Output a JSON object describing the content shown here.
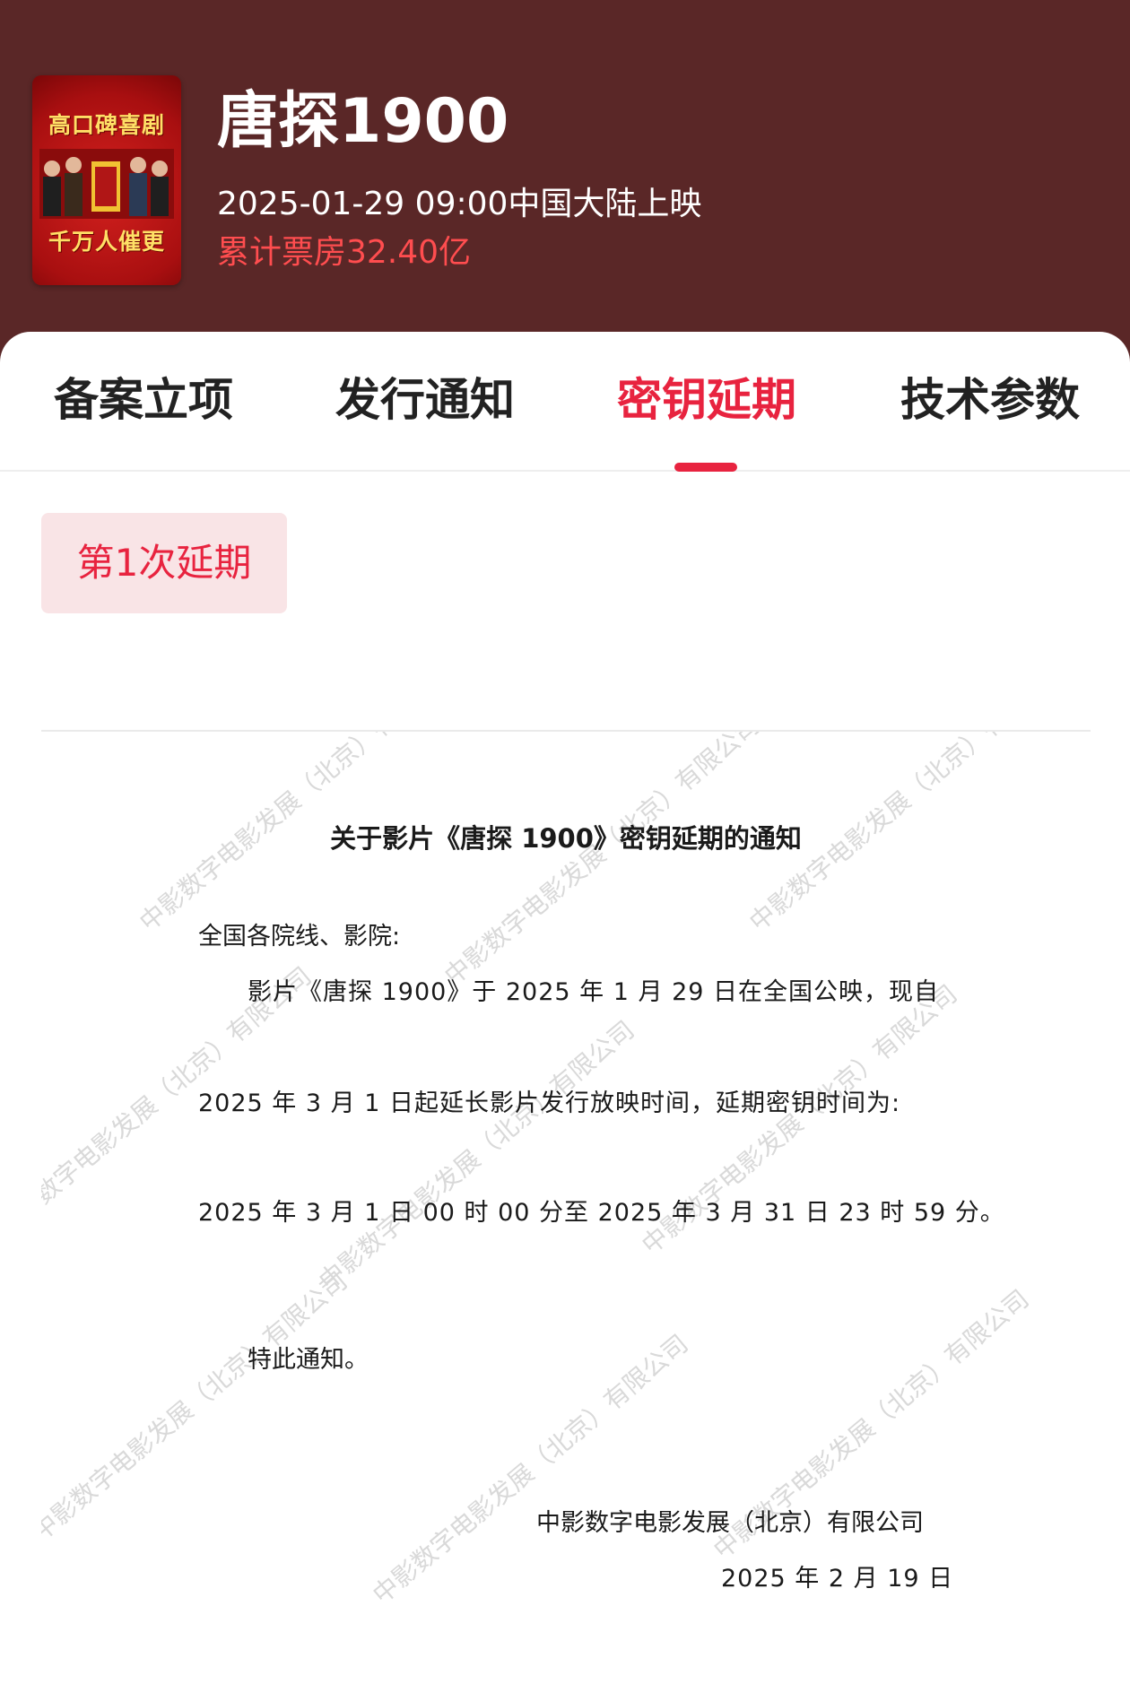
{
  "movie": {
    "title": "唐探1900",
    "release": "2025-01-29 09:00中国大陆上映",
    "box_office": "累计票房32.40亿",
    "poster": {
      "top_text": "高口碑喜剧",
      "bottom_text": "千万人催更"
    }
  },
  "tabs": [
    {
      "label": "备案立项",
      "active": false
    },
    {
      "label": "发行通知",
      "active": false
    },
    {
      "label": "密钥延期",
      "active": true
    },
    {
      "label": "技术参数",
      "active": false
    }
  ],
  "extension_chip": "第1次延期",
  "document": {
    "title": "关于影片《唐探 1900》密钥延期的通知",
    "salutation": "全国各院线、影院:",
    "line1": "影片《唐探 1900》于 2025 年 1 月 29 日在全国公映，现自",
    "line2": "2025 年 3 月 1 日起延长影片发行放映时间，延期密钥时间为:",
    "line3": "2025 年 3 月 1 日 00 时 00 分至 2025 年 3 月 31 日 23 时 59 分。",
    "closing": "特此通知。",
    "issuer": "中影数字电影发展（北京）有限公司",
    "date": "2025 年 2 月 19 日",
    "watermark": "中影数字电影发展（北京）有限公司"
  },
  "colors": {
    "header_bg": "#5a2727",
    "accent": "#e8233f",
    "box_office": "#ff4d4f",
    "chip_bg": "#f9e4e6"
  }
}
